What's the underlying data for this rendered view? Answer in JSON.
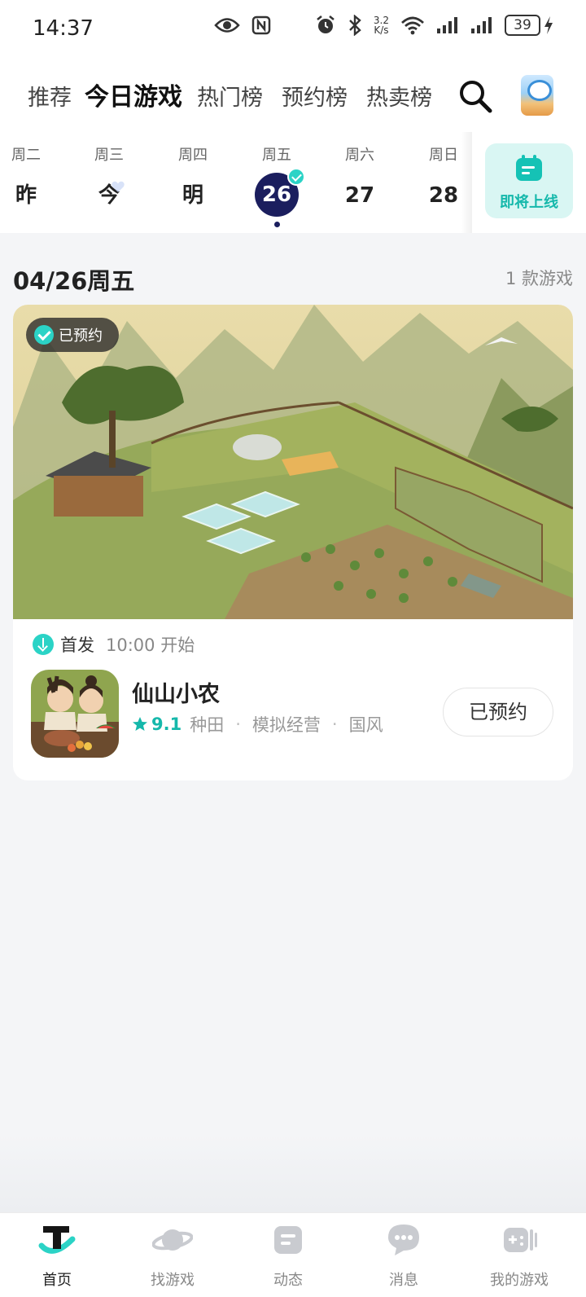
{
  "status_bar": {
    "time": "14:37",
    "net_speed_top": "3.2",
    "net_speed_bottom": "K/s",
    "battery": "39",
    "icons": [
      "eye-icon",
      "nfc-icon",
      "alarm-icon",
      "bluetooth-icon",
      "wifi-icon",
      "signal-icon",
      "signal-icon",
      "battery-icon",
      "charging-icon"
    ]
  },
  "top_nav": {
    "tabs": [
      {
        "label": "推荐"
      },
      {
        "label": "今日游戏"
      },
      {
        "label": "热门榜"
      },
      {
        "label": "预约榜"
      },
      {
        "label": "热卖榜"
      }
    ],
    "active_tab": "今日游戏",
    "accent": "#2bd3c6"
  },
  "days": [
    {
      "week": "周二",
      "day": "昨"
    },
    {
      "week": "周三",
      "day": "今"
    },
    {
      "week": "周四",
      "day": "明"
    },
    {
      "week": "周五",
      "day": "26"
    },
    {
      "week": "周六",
      "day": "27"
    },
    {
      "week": "周日",
      "day": "28"
    }
  ],
  "selected_day": "26",
  "upcoming": {
    "label": "即将上线",
    "icon": "calendar-icon"
  },
  "section": {
    "date": "04/26周五",
    "count": "1 款游戏"
  },
  "game": {
    "reserved_tag": "已预约",
    "launch_label": "首发",
    "launch_time": "10:00 开始",
    "name": "仙山小农",
    "rating": "9.1",
    "tags": [
      "种田",
      "模拟经营",
      "国风"
    ],
    "reserve_button": "已预约"
  },
  "bottom_nav": {
    "items": [
      {
        "label": "首页",
        "icon": "home-icon"
      },
      {
        "label": "找游戏",
        "icon": "planet-icon"
      },
      {
        "label": "动态",
        "icon": "feed-icon"
      },
      {
        "label": "消息",
        "icon": "chat-icon"
      },
      {
        "label": "我的游戏",
        "icon": "gamepad-icon"
      }
    ],
    "active": "首页"
  }
}
